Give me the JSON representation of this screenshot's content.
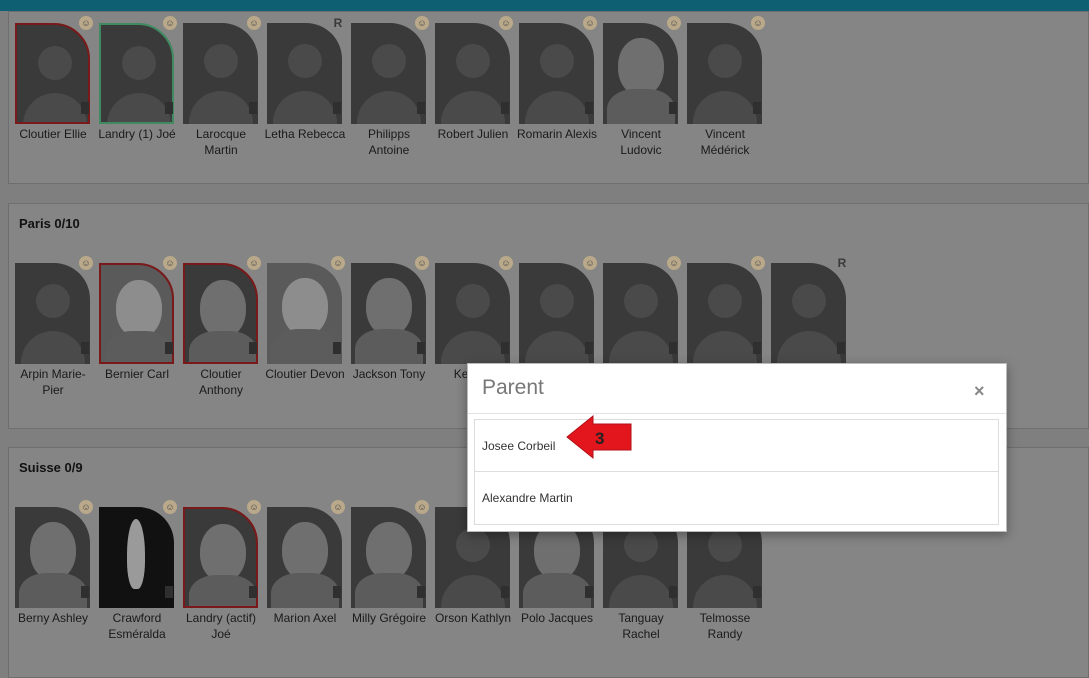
{
  "sections": [
    {
      "title": "",
      "cards": [
        {
          "name": "Cloutier Ellie",
          "border": "red",
          "photo": "silhouette",
          "icon": "face"
        },
        {
          "name": "Landry (1) Joé",
          "border": "green",
          "photo": "silhouette",
          "icon": "face"
        },
        {
          "name": "Larocque Martin",
          "border": "none",
          "photo": "silhouette",
          "icon": "face"
        },
        {
          "name": "Letha Rebecca",
          "border": "none",
          "photo": "silhouette",
          "icon": "R"
        },
        {
          "name": "Philipps Antoine",
          "border": "none",
          "photo": "silhouette",
          "icon": "face"
        },
        {
          "name": "Robert Julien",
          "border": "none",
          "photo": "silhouette",
          "icon": "face"
        },
        {
          "name": "Romarin Alexis",
          "border": "none",
          "photo": "silhouette",
          "icon": "face"
        },
        {
          "name": "Vincent Ludovic",
          "border": "none",
          "photo": "photo",
          "icon": "face"
        },
        {
          "name": "Vincent Médérick",
          "border": "none",
          "photo": "silhouette",
          "icon": "face"
        }
      ]
    },
    {
      "title": "Paris 0/10",
      "cards": [
        {
          "name": "Arpin Marie-Pier",
          "border": "none",
          "photo": "silhouette",
          "icon": "face"
        },
        {
          "name": "Bernier Carl",
          "border": "red",
          "photo": "photo-light",
          "icon": "face"
        },
        {
          "name": "Cloutier Anthony",
          "border": "red",
          "photo": "photo",
          "icon": "face"
        },
        {
          "name": "Cloutier Devon",
          "border": "none",
          "photo": "photo-light",
          "icon": "face"
        },
        {
          "name": "Jackson Tony",
          "border": "none",
          "photo": "cartoon",
          "icon": "face"
        },
        {
          "name": "Ke Van",
          "border": "none",
          "photo": "silhouette",
          "icon": "face"
        },
        {
          "name": "",
          "border": "none",
          "photo": "silhouette",
          "icon": "face"
        },
        {
          "name": "",
          "border": "none",
          "photo": "silhouette",
          "icon": "face"
        },
        {
          "name": "",
          "border": "none",
          "photo": "silhouette",
          "icon": "face"
        },
        {
          "name": "",
          "border": "none",
          "photo": "silhouette",
          "icon": "R"
        }
      ]
    },
    {
      "title": "Suisse 0/9",
      "cards": [
        {
          "name": "Berny Ashley",
          "border": "none",
          "photo": "photo",
          "icon": "face"
        },
        {
          "name": "Crawford Esméralda",
          "border": "none",
          "photo": "flame",
          "icon": "face"
        },
        {
          "name": "Landry (actif) Joé",
          "border": "red",
          "photo": "cartoon",
          "icon": "face"
        },
        {
          "name": "Marion Axel",
          "border": "none",
          "photo": "photo",
          "icon": "face"
        },
        {
          "name": "Milly Grégoire",
          "border": "none",
          "photo": "photo",
          "icon": "face"
        },
        {
          "name": "Orson Kathlyn",
          "border": "none",
          "photo": "silhouette",
          "icon": "face"
        },
        {
          "name": "Polo Jacques",
          "border": "none",
          "photo": "cartoon",
          "icon": "face"
        },
        {
          "name": "Tanguay Rachel",
          "border": "none",
          "photo": "silhouette",
          "icon": "face"
        },
        {
          "name": "Telmosse Randy",
          "border": "none",
          "photo": "silhouette",
          "icon": "face"
        }
      ]
    }
  ],
  "modal": {
    "title": "Parent",
    "close_label": "×",
    "items": [
      "Josee Corbeil",
      "Alexandre Martin"
    ]
  },
  "callout": {
    "label": "3",
    "color": "#e3161e"
  }
}
